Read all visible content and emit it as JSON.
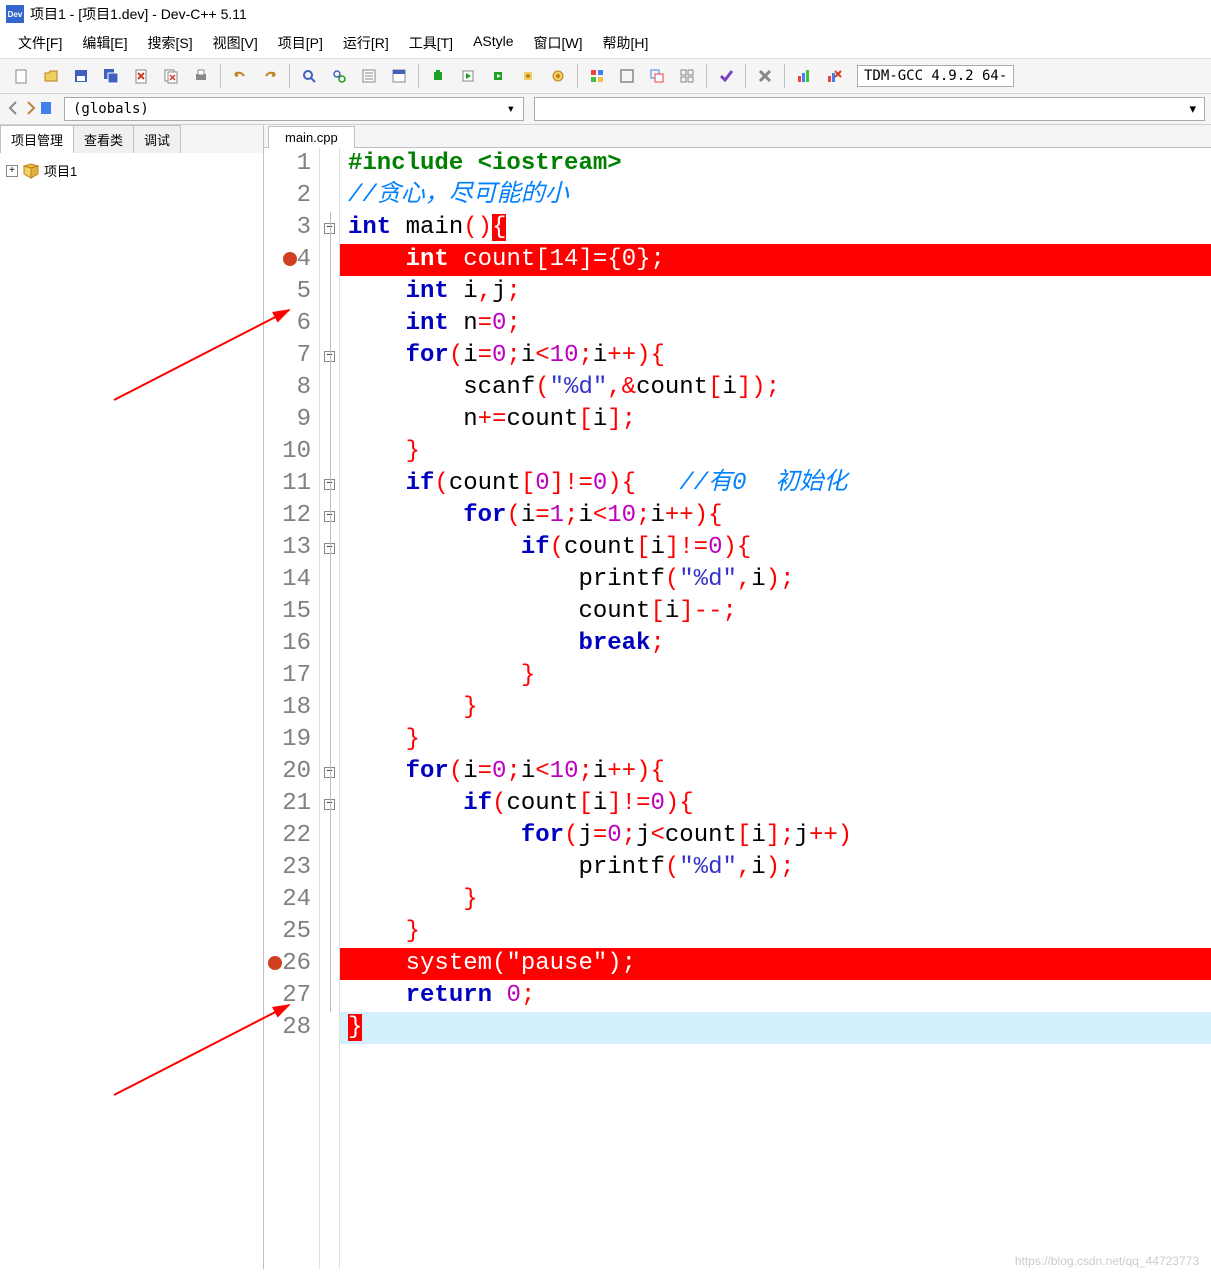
{
  "title": "项目1 - [项目1.dev] - Dev-C++ 5.11",
  "menu": [
    "文件[F]",
    "编辑[E]",
    "搜索[S]",
    "视图[V]",
    "项目[P]",
    "运行[R]",
    "工具[T]",
    "AStyle",
    "窗口[W]",
    "帮助[H]"
  ],
  "compiler": "TDM-GCC 4.9.2 64-",
  "scope": "(globals)",
  "side_tabs": [
    "项目管理",
    "查看类",
    "调试"
  ],
  "project": "项目1",
  "file_tab": "main.cpp",
  "watermark": "https://blog.csdn.net/qq_44723773",
  "lines": [
    {
      "n": 1,
      "fold": "",
      "hl": false,
      "html": "<span class='pp'>#include &lt;iostream&gt;</span>"
    },
    {
      "n": 2,
      "fold": "",
      "hl": false,
      "html": "<span class='cm'>//贪心，尽可能的小</span>"
    },
    {
      "n": 3,
      "fold": "box",
      "hl": false,
      "html": "<span class='kw'>int</span> <span class='fn'>main</span><span class='p'>()</span><span class='p' style='background:#ff0000;color:#fff'>{</span>"
    },
    {
      "n": 4,
      "fold": "line",
      "hl": true,
      "bp": true,
      "html": "    <span class='kw'>int</span> count<span class='p'>[</span><span class='n'>14</span><span class='p'>]={</span><span class='n'>0</span><span class='p'>};</span>"
    },
    {
      "n": 5,
      "fold": "line",
      "hl": false,
      "html": "    <span class='kw'>int</span> i<span class='p'>,</span>j<span class='p'>;</span>"
    },
    {
      "n": 6,
      "fold": "line",
      "hl": false,
      "html": "    <span class='kw'>int</span> n<span class='p'>=</span><span class='n'>0</span><span class='p'>;</span>"
    },
    {
      "n": 7,
      "fold": "box",
      "hl": false,
      "html": "    <span class='kw'>for</span><span class='p'>(</span>i<span class='p'>=</span><span class='n'>0</span><span class='p'>;</span>i<span class='p'>&lt;</span><span class='n'>10</span><span class='p'>;</span>i<span class='p'>++){</span>"
    },
    {
      "n": 8,
      "fold": "line",
      "hl": false,
      "html": "        scanf<span class='p'>(</span><span class='s'>\"%d\"</span><span class='p'>,&amp;</span>count<span class='p'>[</span>i<span class='p'>]);</span>"
    },
    {
      "n": 9,
      "fold": "line",
      "hl": false,
      "html": "        n<span class='p'>+=</span>count<span class='p'>[</span>i<span class='p'>];</span>"
    },
    {
      "n": 10,
      "fold": "line",
      "hl": false,
      "html": "    <span class='p'>}</span>"
    },
    {
      "n": 11,
      "fold": "box",
      "hl": false,
      "html": "    <span class='kw'>if</span><span class='p'>(</span>count<span class='p'>[</span><span class='n'>0</span><span class='p'>]!=</span><span class='n'>0</span><span class='p'>){</span>   <span class='cm'>//有0  初始化</span>"
    },
    {
      "n": 12,
      "fold": "box",
      "hl": false,
      "html": "        <span class='kw'>for</span><span class='p'>(</span>i<span class='p'>=</span><span class='n'>1</span><span class='p'>;</span>i<span class='p'>&lt;</span><span class='n'>10</span><span class='p'>;</span>i<span class='p'>++){</span>"
    },
    {
      "n": 13,
      "fold": "box",
      "hl": false,
      "html": "            <span class='kw'>if</span><span class='p'>(</span>count<span class='p'>[</span>i<span class='p'>]!=</span><span class='n'>0</span><span class='p'>){</span>"
    },
    {
      "n": 14,
      "fold": "line",
      "hl": false,
      "html": "                printf<span class='p'>(</span><span class='s'>\"%d\"</span><span class='p'>,</span>i<span class='p'>);</span>"
    },
    {
      "n": 15,
      "fold": "line",
      "hl": false,
      "html": "                count<span class='p'>[</span>i<span class='p'>]--;</span>"
    },
    {
      "n": 16,
      "fold": "line",
      "hl": false,
      "html": "                <span class='kw'>break</span><span class='p'>;</span>"
    },
    {
      "n": 17,
      "fold": "line",
      "hl": false,
      "html": "            <span class='p'>}</span>"
    },
    {
      "n": 18,
      "fold": "line",
      "hl": false,
      "html": "        <span class='p'>}</span>"
    },
    {
      "n": 19,
      "fold": "line",
      "hl": false,
      "html": "    <span class='p'>}</span>"
    },
    {
      "n": 20,
      "fold": "box",
      "hl": false,
      "html": "    <span class='kw'>for</span><span class='p'>(</span>i<span class='p'>=</span><span class='n'>0</span><span class='p'>;</span>i<span class='p'>&lt;</span><span class='n'>10</span><span class='p'>;</span>i<span class='p'>++){</span>"
    },
    {
      "n": 21,
      "fold": "box",
      "hl": false,
      "html": "        <span class='kw'>if</span><span class='p'>(</span>count<span class='p'>[</span>i<span class='p'>]!=</span><span class='n'>0</span><span class='p'>){</span>"
    },
    {
      "n": 22,
      "fold": "line",
      "hl": false,
      "html": "            <span class='kw'>for</span><span class='p'>(</span>j<span class='p'>=</span><span class='n'>0</span><span class='p'>;</span>j<span class='p'>&lt;</span>count<span class='p'>[</span>i<span class='p'>];</span>j<span class='p'>++)</span>"
    },
    {
      "n": 23,
      "fold": "line",
      "hl": false,
      "html": "                printf<span class='p'>(</span><span class='s'>\"%d\"</span><span class='p'>,</span>i<span class='p'>);</span>"
    },
    {
      "n": 24,
      "fold": "line",
      "hl": false,
      "html": "        <span class='p'>}</span>"
    },
    {
      "n": 25,
      "fold": "line",
      "hl": false,
      "html": "    <span class='p'>}</span>"
    },
    {
      "n": 26,
      "fold": "line",
      "hl": true,
      "bp": true,
      "html": "    system<span class='p'>(</span><span class='s'>\"pause\"</span><span class='p'>);</span>"
    },
    {
      "n": 27,
      "fold": "line",
      "hl": false,
      "html": "    <span class='kw'>return</span> <span class='n'>0</span><span class='p'>;</span>"
    },
    {
      "n": 28,
      "fold": "",
      "hl": false,
      "cur": true,
      "html": "<span class='p' style='background:#ff0000;color:#fff'>}</span>"
    }
  ],
  "toolbar_icons": [
    "new-file",
    "open-file",
    "save",
    "save-all",
    "close",
    "close-all",
    "print",
    "",
    "undo",
    "redo",
    "",
    "find",
    "replace",
    "find-in-files",
    "goto",
    "",
    "compile",
    "run",
    "compile-run",
    "rebuild",
    "debug",
    "",
    "grid",
    "window",
    "windows",
    "tile",
    "",
    "check",
    "",
    "close-x",
    "",
    "chart",
    "debug-stop"
  ],
  "toolbar2_icons": [
    "back",
    "forward",
    "bookmark"
  ]
}
